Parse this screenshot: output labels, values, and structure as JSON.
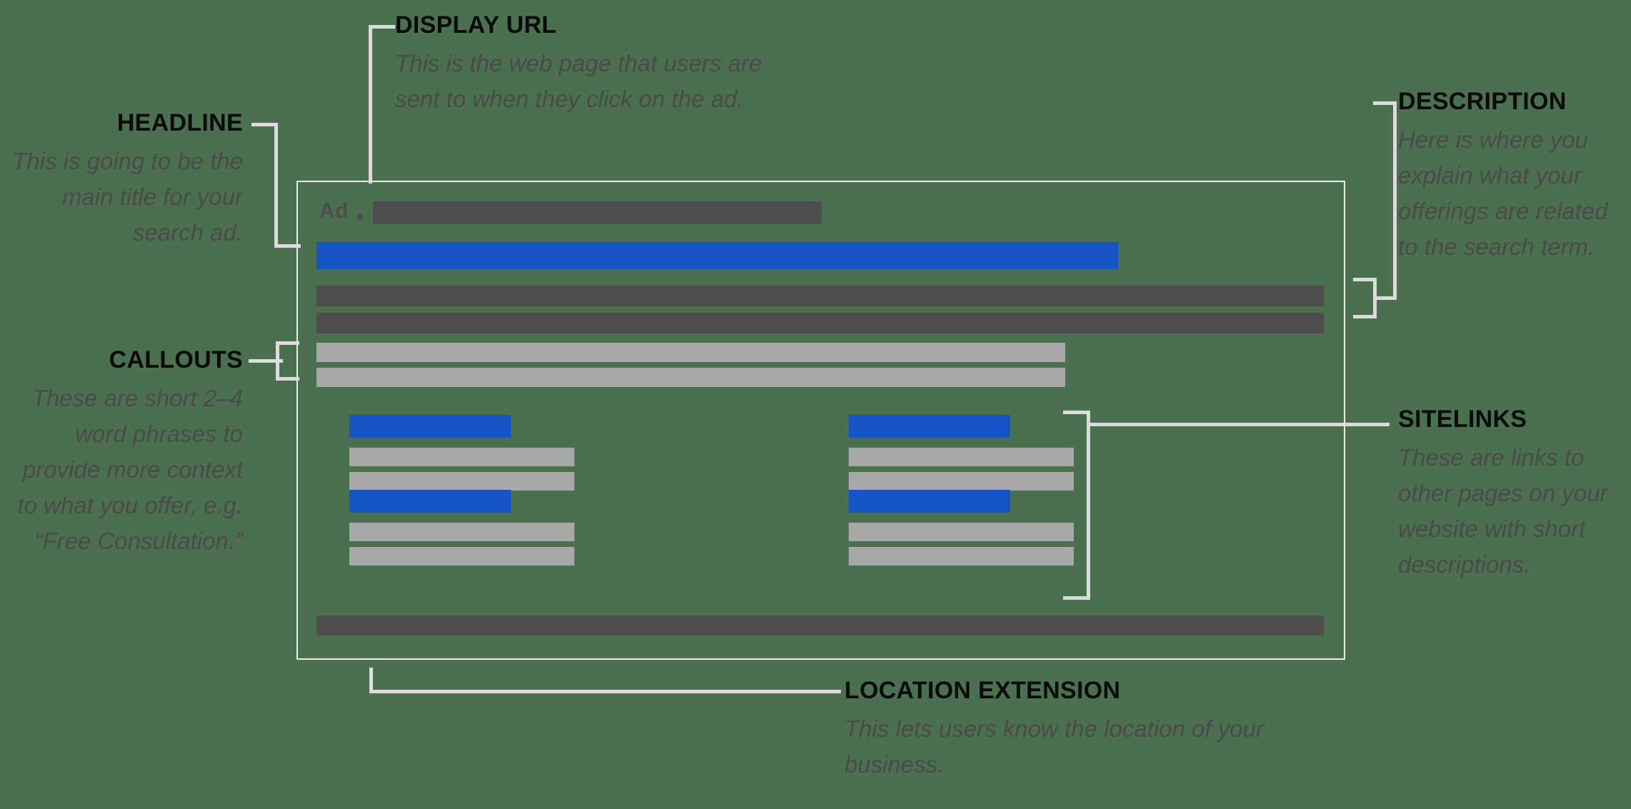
{
  "meta": {
    "background_color": "#4a7050",
    "accent_blue": "#1554c5",
    "dark_gray": "#4d4d4d",
    "light_gray": "#a8a8a8",
    "line_color": "#dcdcdc",
    "heading_color": "#0b0b0b",
    "body_color": "#4a4a4a"
  },
  "annotations": {
    "headline": {
      "title": "HEADLINE",
      "body": "This is going to be the main title for your search ad."
    },
    "display_url": {
      "title": "DISPLAY URL",
      "body": "This is the web page that users are sent to when they click on the ad."
    },
    "description": {
      "title": "DESCRIPTION",
      "body": "Here is where you explain what your offerings are related to the search term."
    },
    "callouts": {
      "title": "CALLOUTS",
      "body": "These are short 2–4 word phrases to provide more context to what you offer, e.g. “Free Consultation.”"
    },
    "sitelinks": {
      "title": "SITELINKS",
      "body": "These are links to other pages on your website with short descriptions."
    },
    "location_extension": {
      "title": "LOCATION EXTENSION",
      "body": "This lets users know the location of your business."
    }
  },
  "ad_mock": {
    "ad_label": "Ad",
    "separator": "·",
    "display_url_bar": {
      "color": "#4d4d4d"
    },
    "headline_bar": {
      "color": "#1554c5"
    },
    "description_bars": [
      {
        "color": "#4d4d4d"
      },
      {
        "color": "#4d4d4d"
      }
    ],
    "callout_bars": [
      {
        "color": "#a8a8a8"
      },
      {
        "color": "#a8a8a8"
      }
    ],
    "sitelinks": [
      {
        "title_color": "#1554c5",
        "desc_colors": [
          "#a8a8a8",
          "#a8a8a8"
        ]
      },
      {
        "title_color": "#1554c5",
        "desc_colors": [
          "#a8a8a8",
          "#a8a8a8"
        ]
      },
      {
        "title_color": "#1554c5",
        "desc_colors": [
          "#a8a8a8",
          "#a8a8a8"
        ]
      },
      {
        "title_color": "#1554c5",
        "desc_colors": [
          "#a8a8a8",
          "#a8a8a8"
        ]
      }
    ],
    "location_bar": {
      "color": "#4d4d4d"
    }
  }
}
